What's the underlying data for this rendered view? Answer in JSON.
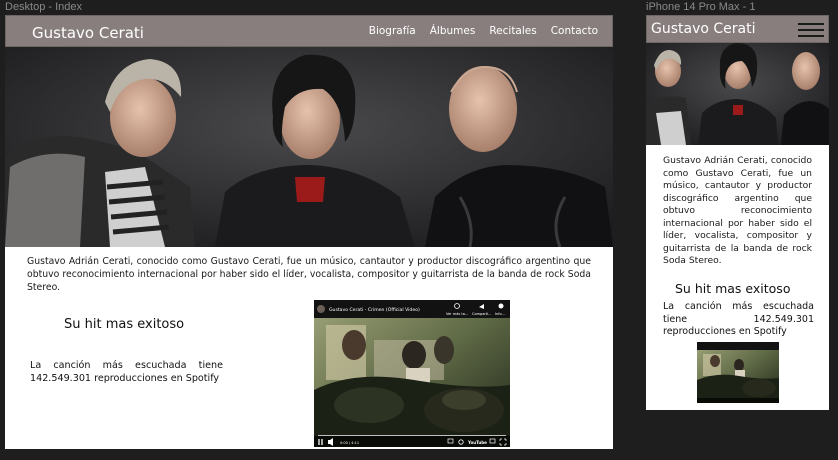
{
  "canvas": {
    "desktop_label": "Desktop - Index",
    "mobile_label": "iPhone 14 Pro Max - 1"
  },
  "site": {
    "brand": "Gustavo Cerati",
    "nav": [
      "Biografía",
      "Álbumes",
      "Recitales",
      "Contacto"
    ],
    "bio": "Gustavo Adrián Cerati, conocido como Gustavo Cerati, fue un músico, cantautor y productor discográfico argentino que obtuvo reconocimiento internacional por haber sido el líder, vocalista, compositor y guitarrista de la banda de rock Soda Stereo.",
    "hit_title": "Su hit mas exitoso",
    "hit_text": "La canción más escuchada tiene 142.549.301 reproducciones en Spotify"
  },
  "video": {
    "title": "Gustavo Cerati - Crimen (Official Video)",
    "watch_later": "Ver más ta...",
    "share": "Comparti...",
    "info": "Info...",
    "time": "0:00 / 4:11",
    "brand": "YouTube"
  },
  "colors": {
    "canvas_bg": "#1e1e1e",
    "nav_bg": "#887e7e",
    "page_bg": "#ffffff"
  }
}
